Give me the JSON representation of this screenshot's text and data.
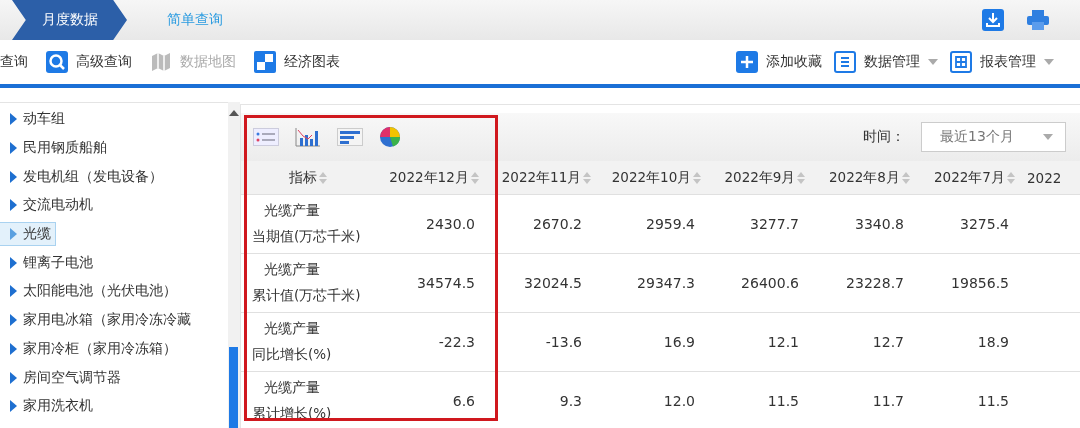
{
  "breadcrumb": [
    {
      "label": "月度数据",
      "selected": true
    },
    {
      "label": "简单查询",
      "selected": false
    }
  ],
  "toolbar_left": [
    {
      "label": "查询",
      "kind": "plain",
      "disabled": false
    },
    {
      "label": "高级查询",
      "kind": "search",
      "disabled": false
    },
    {
      "label": "数据地图",
      "kind": "map",
      "disabled": true
    },
    {
      "label": "经济图表",
      "kind": "chart",
      "disabled": false
    }
  ],
  "toolbar_right": [
    {
      "label": "添加收藏",
      "kind": "plus",
      "dropdown": false
    },
    {
      "label": "数据管理",
      "kind": "list",
      "dropdown": true
    },
    {
      "label": "报表管理",
      "kind": "grid",
      "dropdown": true
    }
  ],
  "sidebar": {
    "items": [
      {
        "label": "动车组",
        "selected": false
      },
      {
        "label": "民用钢质船舶",
        "selected": false
      },
      {
        "label": "发电机组（发电设备）",
        "selected": false
      },
      {
        "label": "交流电动机",
        "selected": false
      },
      {
        "label": "光缆",
        "selected": true
      },
      {
        "label": "锂离子电池",
        "selected": false
      },
      {
        "label": "太阳能电池（光伏电池）",
        "selected": false
      },
      {
        "label": "家用电冰箱（家用冷冻冷藏",
        "selected": false
      },
      {
        "label": "家用冷柜（家用冷冻箱）",
        "selected": false
      },
      {
        "label": "房间空气调节器",
        "selected": false
      },
      {
        "label": "家用洗衣机",
        "selected": false
      }
    ]
  },
  "time_filter": {
    "label": "时间：",
    "value": "最近13个月"
  },
  "table": {
    "columns": [
      "指标",
      "2022年12月",
      "2022年11月",
      "2022年10月",
      "2022年9月",
      "2022年8月",
      "2022年7月",
      "2022"
    ],
    "rows": [
      {
        "indicator": [
          "光缆产量",
          "当期值(万芯千米)"
        ],
        "values": [
          "2430.0",
          "2670.2",
          "2959.4",
          "3277.7",
          "3340.8",
          "3275.4"
        ]
      },
      {
        "indicator": [
          "光缆产量",
          "累计值(万芯千米)"
        ],
        "values": [
          "34574.5",
          "32024.5",
          "29347.3",
          "26400.6",
          "23228.7",
          "19856.5"
        ]
      },
      {
        "indicator": [
          "光缆产量",
          "同比增长(%)"
        ],
        "values": [
          "-22.3",
          "-13.6",
          "16.9",
          "12.1",
          "12.7",
          "18.9"
        ]
      },
      {
        "indicator": [
          "光缆产量",
          "累计增长(%)"
        ],
        "values": [
          "6.6",
          "9.3",
          "12.0",
          "11.5",
          "11.7",
          "11.5"
        ]
      }
    ]
  }
}
